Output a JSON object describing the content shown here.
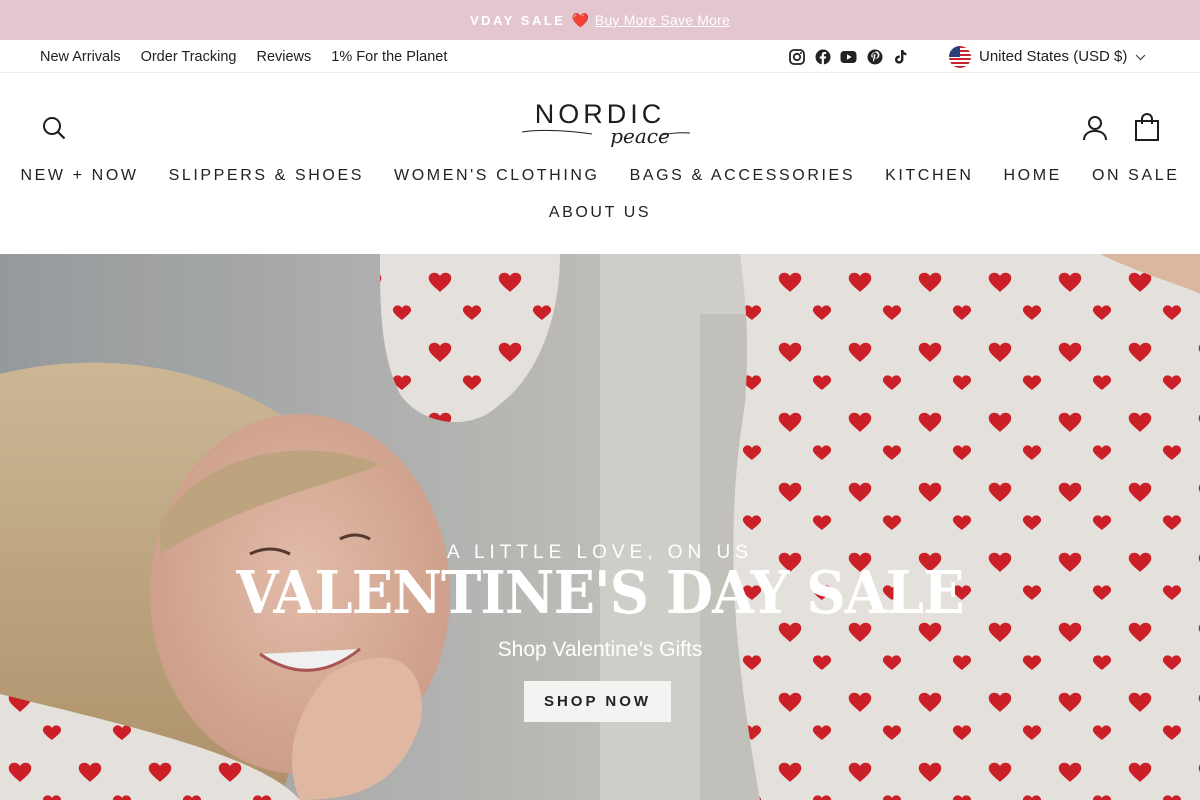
{
  "announcement": {
    "label": "VDAY SALE",
    "emoji": "❤️",
    "link_text": "Buy More Save More"
  },
  "utility": {
    "links": [
      "New Arrivals",
      "Order Tracking",
      "Reviews",
      "1% For the Planet"
    ],
    "social_icons": [
      "instagram-icon",
      "facebook-icon",
      "youtube-icon",
      "pinterest-icon",
      "tiktok-icon"
    ],
    "currency": "United States (USD $)"
  },
  "header": {
    "logo_main": "NORDIC",
    "logo_script": "peace",
    "nav": [
      "NEW + NOW",
      "SLIPPERS & SHOES",
      "WOMEN'S CLOTHING",
      "BAGS & ACCESSORIES",
      "KITCHEN",
      "HOME",
      "ON SALE"
    ],
    "nav_row2": [
      "ABOUT US"
    ]
  },
  "hero": {
    "kicker": "A LITTLE LOVE, ON US",
    "title": "VALENTINE'S DAY SALE",
    "subtitle": "Shop Valentine’s Gifts",
    "cta": "SHOP NOW"
  },
  "colors": {
    "announcement_bg": "#e4c6d1",
    "heart_red": "#d8232a"
  }
}
